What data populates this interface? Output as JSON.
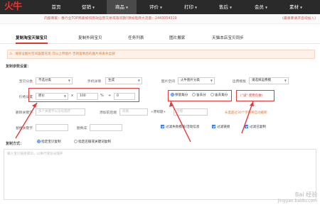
{
  "app": {
    "logo": "火牛"
  },
  "nav": [
    {
      "label": "首页",
      "caret": false,
      "active": false
    },
    {
      "label": "促销",
      "caret": true,
      "active": false
    },
    {
      "label": "商品",
      "caret": true,
      "active": true
    },
    {
      "label": "评价",
      "caret": true,
      "active": false
    },
    {
      "label": "打印",
      "caret": true,
      "active": false
    },
    {
      "label": "售后",
      "caret": true,
      "active": false
    },
    {
      "label": "会员",
      "caret": true,
      "active": false
    },
    {
      "label": "素材",
      "caret": true,
      "active": false
    }
  ],
  "announcement": {
    "text": "内部商家：香行业TOP商家如何高效运营交易或等问题?添加电商大流量：2443054319",
    "right": "(最重要请求咨询加入)"
  },
  "tabs": [
    "复制淘宝天猫宝贝",
    "复制外网宝贝",
    "任务列表",
    "图片搬家",
    "天猫本店宝贝同步"
  ],
  "warning": "请保证图片空间容量充足 可以上传图片 否则复制后的图片将丢失全部",
  "params_title": "复制参数设置：",
  "form": {
    "category_label": "宝贝分类",
    "category_value": "不选分类",
    "shop_cat_label": "手机详情",
    "shop_cat_value": "生成",
    "image_space_label": "图片空间",
    "image_space_value": "火牛图片分类",
    "shipping_label": "运费模板",
    "shipping_value": "请选择运费模",
    "price_label": "价格设置",
    "price_base": "原价",
    "price_mult_op": "x",
    "price_percent": "100",
    "price_percent_unit": "%",
    "price_plus_op": "+",
    "price_add": "0",
    "rounding_options": [
      "保留角分",
      "舍去分",
      "舍去角分"
    ],
    "rounding_selected": 0,
    "note_red": "(\"减\" 使用负数)",
    "title_replace_label": "删除关键字",
    "title_replace_placeholder": "多个关键字以逗号隔开",
    "title_add_label": "添加前后缀",
    "title_prefix_placeholder": "前缀",
    "title_suffix_label": "+原标题+",
    "title_suffix_placeholder": "后缀",
    "title_note": "长度超过30个字符将自动截断",
    "stock_label": "替换关键字",
    "stock_replace_label": "替换成",
    "checkboxes": [
      "过滤失败模板/活动信息",
      "过滤链接",
      "过滤已复制"
    ],
    "copy_mode_label": "复制方式：",
    "copy_modes": [
      "指定宝贝复制",
      "指定店铺或关键词复制"
    ],
    "copy_mode_selected": 0,
    "textarea_placeholder": "输入宝贝链接或ID，以换行或逗号隔开"
  },
  "watermark": {
    "main": "Bai 经验",
    "sub": "jingyan.baidu.com"
  }
}
